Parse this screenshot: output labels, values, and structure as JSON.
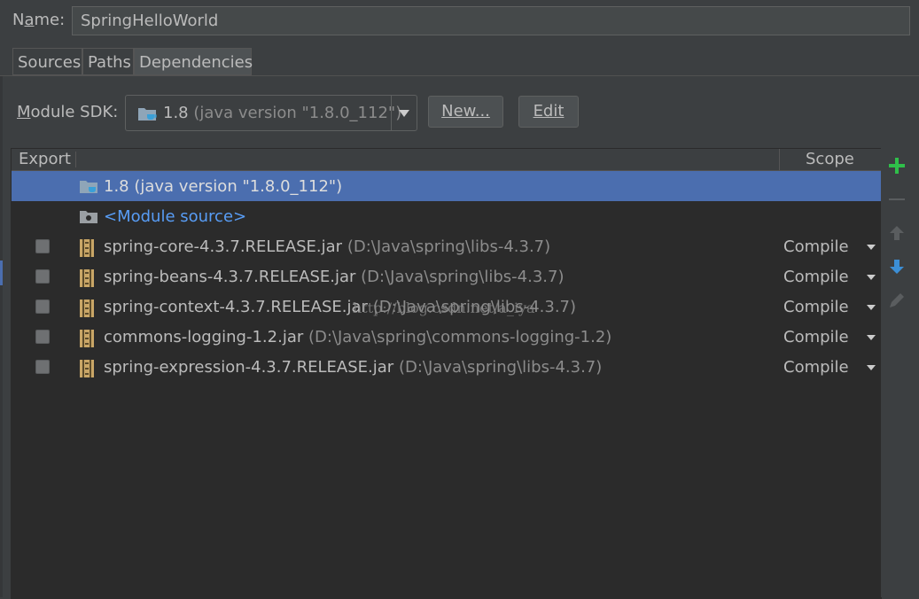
{
  "name_row": {
    "label": "Name:",
    "value": "SpringHelloWorld"
  },
  "tabs": [
    {
      "label": "Sources",
      "active": false
    },
    {
      "label": "Paths",
      "active": false
    },
    {
      "label": "Dependencies",
      "active": true
    }
  ],
  "sdk": {
    "label": "Module SDK:",
    "version": "1.8",
    "detail": "(java version \"1.8.0_112\")",
    "new_label": "New...",
    "edit_label": "Edit"
  },
  "table": {
    "headers": {
      "export": "Export",
      "scope": "Scope"
    },
    "sdk_row": {
      "name": "1.8 (java version \"1.8.0_112\")"
    },
    "module_source_row": {
      "name": "<Module source>"
    },
    "rows": [
      {
        "name": "spring-core-4.3.7.RELEASE.jar",
        "path": "(D:\\Java\\spring\\libs-4.3.7)",
        "scope": "Compile"
      },
      {
        "name": "spring-beans-4.3.7.RELEASE.jar",
        "path": "(D:\\Java\\spring\\libs-4.3.7)",
        "scope": "Compile"
      },
      {
        "name": "spring-context-4.3.7.RELEASE.jar",
        "path": "(D:\\Java\\spring\\libs-4.3.7)",
        "scope": "Compile"
      },
      {
        "name": "commons-logging-1.2.jar",
        "path": "(D:\\Java\\spring\\commons-logging-1.2)",
        "scope": "Compile"
      },
      {
        "name": "spring-expression-4.3.7.RELEASE.jar",
        "path": "(D:\\Java\\spring\\libs-4.3.7)",
        "scope": "Compile"
      }
    ]
  },
  "watermark": "http://blog.csdn.net/a_iya",
  "toolbar": {
    "icons": [
      "add-icon",
      "remove-icon",
      "move-up-icon",
      "move-down-icon",
      "edit-icon"
    ]
  },
  "colors": {
    "background": "#3c3f41",
    "table_bg": "#2b2b2b",
    "selection": "#4b6eaf",
    "add_green": "#2fbf4a",
    "move_down_blue": "#3c8fd6",
    "module_source_blue": "#589df6"
  }
}
